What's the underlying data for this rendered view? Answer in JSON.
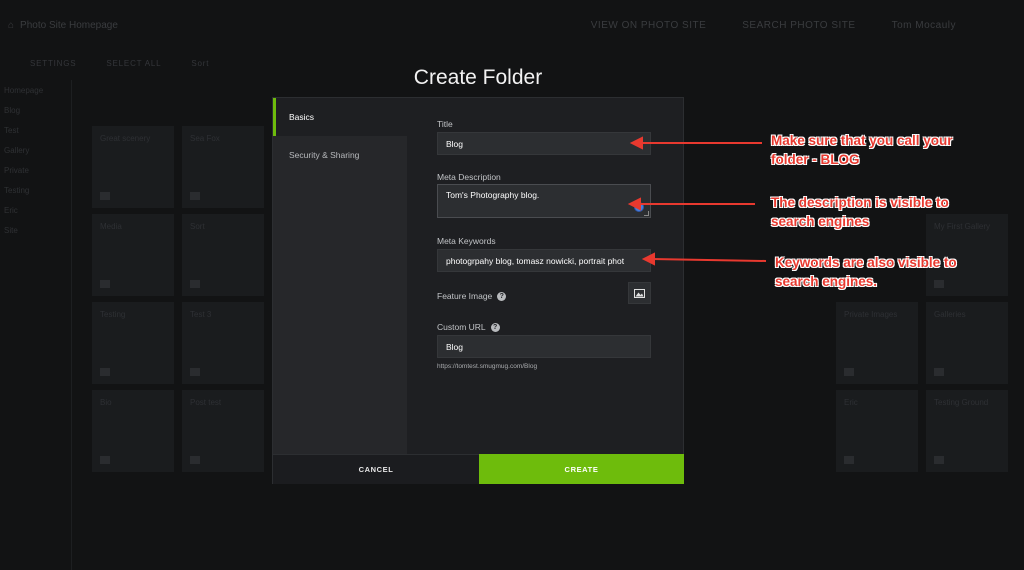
{
  "background": {
    "site_title": "Photo Site Homepage",
    "top_links": [
      "VIEW ON PHOTO SITE",
      "SEARCH PHOTO SITE",
      "Tom Mocauly"
    ],
    "toolbar": [
      "SETTINGS",
      "SELECT ALL",
      "Sort"
    ],
    "sidebar": [
      "Homepage",
      "Blog",
      "Test",
      "Gallery",
      "Private",
      "Testing",
      "Eric",
      "Site"
    ],
    "tiles": [
      "Great scenery",
      "Sea Fox",
      "Media",
      "Sort",
      "Testing",
      "Test 3",
      "Bio",
      "Post test",
      "My First Gallery",
      "Private Images",
      "Galleries",
      "Eric",
      "Testing Ground"
    ]
  },
  "modal": {
    "title": "Create Folder",
    "nav": {
      "basics": "Basics",
      "security": "Security & Sharing"
    },
    "fields": {
      "title_label": "Title",
      "title_value": "Blog",
      "meta_description_label": "Meta Description",
      "meta_description_value": "Tom's Photography blog.",
      "meta_keywords_label": "Meta Keywords",
      "meta_keywords_value": "photogrpahy blog, tomasz nowicki, portrait phot",
      "feature_image_label": "Feature Image",
      "custom_url_label": "Custom URL",
      "custom_url_value": "Blog",
      "url_hint": "https://tomtest.smugmug.com/Blog"
    },
    "buttons": {
      "cancel": "CANCEL",
      "create": "CREATE"
    }
  },
  "annotations": {
    "title_note_line1": "Make sure that you call your",
    "title_note_line2": "folder - BLOG",
    "description_note_line1": "The description is visible to",
    "description_note_line2": "search engines",
    "keywords_note_line1": "Keywords are also visible to",
    "keywords_note_line2": "search engines."
  },
  "colors": {
    "accent": "#6ebc0c",
    "annotation": "#e8392f"
  },
  "icons": [
    "home-icon",
    "help-icon",
    "image-icon",
    "arrow-icon"
  ]
}
